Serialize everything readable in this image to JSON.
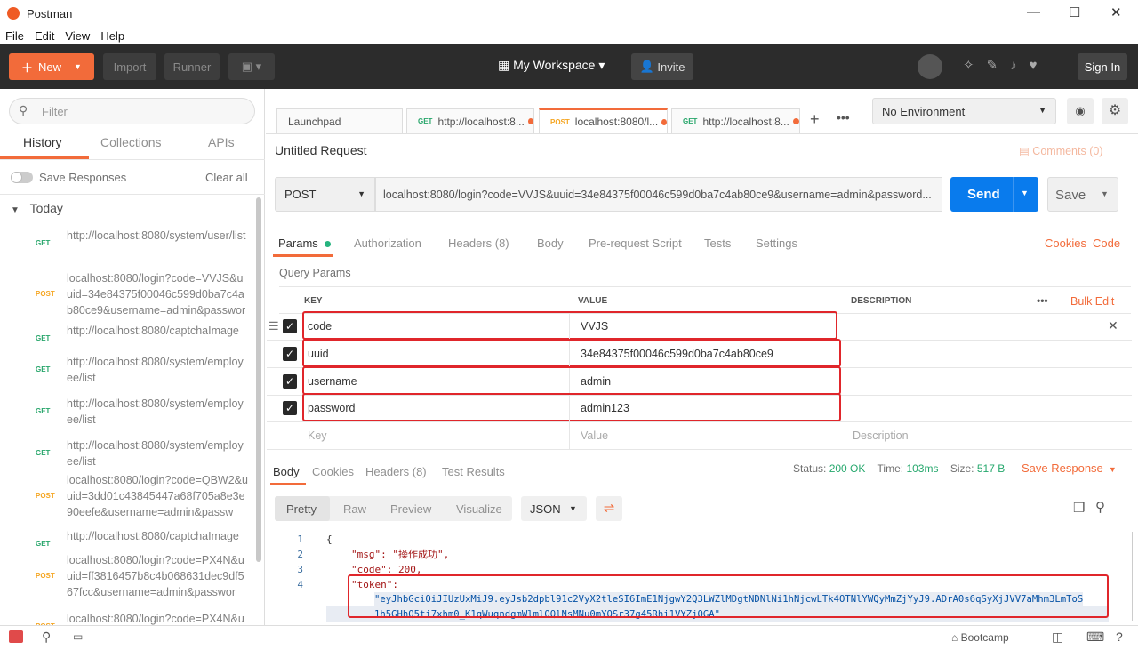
{
  "window": {
    "title": "Postman",
    "minimize": "—",
    "maximize": "☐",
    "close": "✕"
  },
  "menu": [
    "File",
    "Edit",
    "View",
    "Help"
  ],
  "toolbar": {
    "new": "New",
    "import": "Import",
    "runner": "Runner",
    "workspace": "My Workspace",
    "invite": "Invite",
    "sign_in": "Sign In"
  },
  "sidebar": {
    "filter_placeholder": "Filter",
    "tabs": [
      "History",
      "Collections",
      "APIs"
    ],
    "save_responses": "Save Responses",
    "clear_all": "Clear all",
    "group": "Today",
    "items": [
      {
        "method": "GET",
        "url": "http://localhost:8080/system/user/list"
      },
      {
        "method": "POST",
        "url": "localhost:8080/login?code=VVJS&uuid=34e84375f00046c599d0ba7c4ab80ce9&username=admin&passwor"
      },
      {
        "method": "GET",
        "url": "http://localhost:8080/captchaImage"
      },
      {
        "method": "GET",
        "url": "http://localhost:8080/system/employee/list"
      },
      {
        "method": "GET",
        "url": "http://localhost:8080/system/employee/list"
      },
      {
        "method": "GET",
        "url": "http://localhost:8080/system/employee/list"
      },
      {
        "method": "POST",
        "url": "localhost:8080/login?code=QBW2&uuid=3dd01c43845447a68f705a8e3e90eefe&username=admin&passw"
      },
      {
        "method": "GET",
        "url": "http://localhost:8080/captchaImage"
      },
      {
        "method": "POST",
        "url": "localhost:8080/login?code=PX4N&uuid=ff3816457b8c4b068631dec9df567fcc&username=admin&passwor"
      },
      {
        "method": "POST",
        "url": "localhost:8080/login?code=PX4N&u"
      }
    ]
  },
  "tabs": [
    {
      "label": "Launchpad"
    },
    {
      "method": "GET",
      "label": "http://localhost:8..."
    },
    {
      "method": "POST",
      "label": "localhost:8080/l..."
    },
    {
      "method": "GET",
      "label": "http://localhost:8..."
    }
  ],
  "environment": "No Environment",
  "request": {
    "name": "Untitled Request",
    "comments": "Comments (0)",
    "method": "POST",
    "url": "localhost:8080/login?code=VVJS&uuid=34e84375f00046c599d0ba7c4ab80ce9&username=admin&password...",
    "send": "Send",
    "save": "Save"
  },
  "req_tabs": {
    "params": "Params",
    "authorization": "Authorization",
    "headers": "Headers (8)",
    "body": "Body",
    "prerequest": "Pre-request Script",
    "tests": "Tests",
    "settings": "Settings",
    "cookies": "Cookies",
    "code": "Code"
  },
  "params": {
    "title": "Query Params",
    "col_key": "KEY",
    "col_value": "VALUE",
    "col_desc": "DESCRIPTION",
    "bulk_edit": "Bulk Edit",
    "rows": [
      {
        "key": "code",
        "value": "VVJS"
      },
      {
        "key": "uuid",
        "value": "34e84375f00046c599d0ba7c4ab80ce9"
      },
      {
        "key": "username",
        "value": "admin"
      },
      {
        "key": "password",
        "value": "admin123"
      }
    ],
    "key_placeholder": "Key",
    "value_placeholder": "Value",
    "desc_placeholder": "Description"
  },
  "response": {
    "tabs": [
      "Body",
      "Cookies",
      "Headers (8)",
      "Test Results"
    ],
    "status_label": "Status:",
    "status": "200 OK",
    "time_label": "Time:",
    "time": "103ms",
    "size_label": "Size:",
    "size": "517 B",
    "save_response": "Save Response",
    "views": [
      "Pretty",
      "Raw",
      "Preview",
      "Visualize"
    ],
    "format": "JSON",
    "lines": [
      "{",
      "\"msg\": \"操作成功\",",
      "\"code\": 200,",
      "\"token\":",
      "\"eyJhbGciOiJIUzUxMiJ9.eyJsb2dpbl91c2VyX2tleSI6ImE1NjgwY2Q3LWZlMDgtNDNlNi1hNjcwLTk4OTNlYWQyMmZjYyJ9.ADrA0s6qSyXjJVV7aMhm3LmToS",
      "1h5GHhQ5ti7xhm0_K1qWuqndgmWlmlOQlNsMNu0mYQSr37g45Rhi1VYZjOGA\""
    ],
    "line_numbers": [
      "1",
      "2",
      "3",
      "4"
    ]
  },
  "statusbar": {
    "bootcamp": "Bootcamp"
  }
}
